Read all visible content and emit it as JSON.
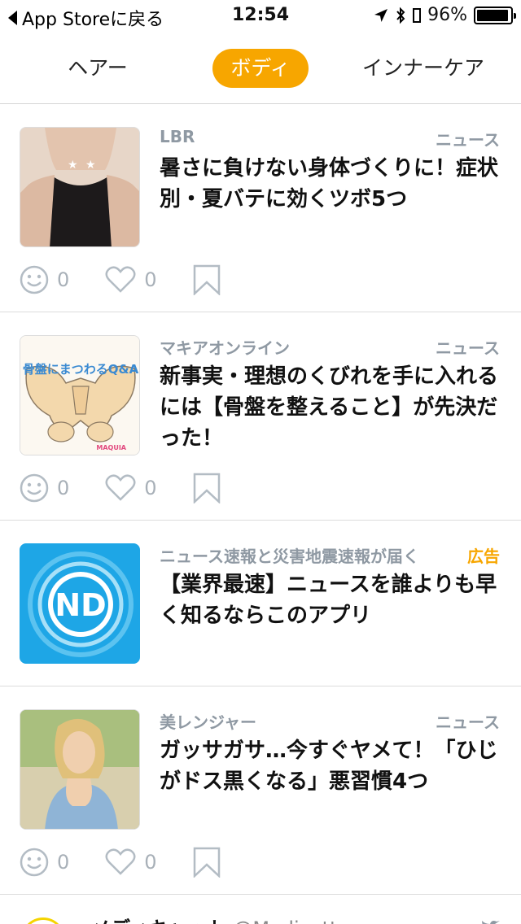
{
  "status_bar": {
    "back_label": "App Storeに戻る",
    "time": "12:54",
    "battery": "96%",
    "battery_level": 0.96
  },
  "tabs": [
    {
      "label": "ヘアー",
      "active": false
    },
    {
      "label": "ボディ",
      "active": true
    },
    {
      "label": "インナーケア",
      "active": false
    }
  ],
  "feed": [
    {
      "source": "LBR",
      "category": "ニュース",
      "title": "暑さに負けない身体づくりに！症状別・夏バテに効くツボ5つ",
      "smile_count": "0",
      "like_count": "0"
    },
    {
      "source": "マキアオンライン",
      "category": "ニュース",
      "title": "新事実・理想のくびれを手に入れるには【骨盤を整えること】が先決だった！",
      "smile_count": "0",
      "like_count": "0",
      "thumb_text": "骨盤にまつわるQ&A",
      "thumb_brand": "MAQUIA"
    },
    {
      "source": "ニュース速報と災害地震速報が届く",
      "category": "広告",
      "title": "【業界最速】ニュースを誰よりも早く知るならこのアプリ",
      "thumb_text": "ND"
    },
    {
      "source": "美レンジャー",
      "category": "ニュース",
      "title": "ガッサガサ…今すぐヤメて！「ひじがドス黒くなる」悪習慣4つ",
      "smile_count": "0",
      "like_count": "0"
    }
  ],
  "peek": {
    "name": "メディキャット",
    "handle": "@Medicatto"
  },
  "colors": {
    "accent": "#f7a600",
    "meta_gray": "#8f99a3",
    "icon_gray": "#a8b0b8"
  },
  "icons": [
    "location-arrow-icon",
    "bluetooth-icon",
    "battery-icon",
    "smile-icon",
    "heart-icon",
    "bookmark-icon",
    "twitter-bird-icon"
  ]
}
